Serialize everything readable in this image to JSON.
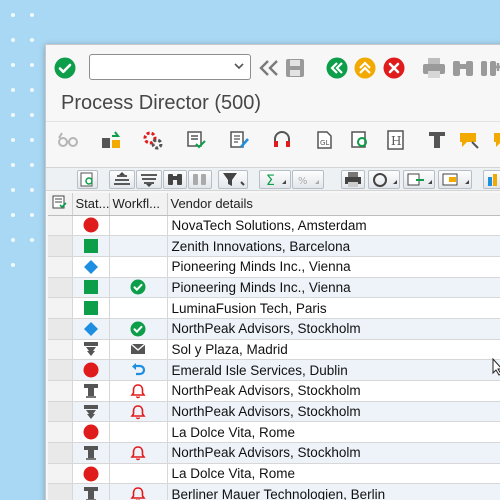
{
  "app": {
    "title": "Process Director (500)"
  },
  "toolbar": {
    "command_placeholder": ""
  },
  "table": {
    "headers": {
      "status": "Stat...",
      "workflow": "Workfl...",
      "vendor": "Vendor details"
    },
    "rows": [
      {
        "status": "red-circle-icon",
        "workflow": "",
        "vendor": "NovaTech Solutions, Amsterdam"
      },
      {
        "status": "green-square-icon",
        "workflow": "",
        "vendor": "Zenith Innovations, Barcelona"
      },
      {
        "status": "blue-diamond-icon",
        "workflow": "",
        "vendor": "Pioneering Minds Inc., Vienna"
      },
      {
        "status": "green-square-icon",
        "workflow": "check-icon",
        "vendor": "Pioneering Minds Inc., Vienna"
      },
      {
        "status": "green-square-icon",
        "workflow": "",
        "vendor": "LuminaFusion Tech, Paris"
      },
      {
        "status": "blue-diamond-icon",
        "workflow": "check-icon",
        "vendor": "NorthPeak Advisors, Stockholm"
      },
      {
        "status": "stamp-arrow-icon",
        "workflow": "envelope-icon",
        "vendor": "Sol y Plaza, Madrid"
      },
      {
        "status": "red-circle-icon",
        "workflow": "undo-arrow-icon",
        "vendor": "Emerald Isle Services, Dublin"
      },
      {
        "status": "stamp-icon",
        "workflow": "bell-icon",
        "vendor": "NorthPeak Advisors, Stockholm"
      },
      {
        "status": "stamp-arrow-icon",
        "workflow": "bell-icon",
        "vendor": "NorthPeak Advisors, Stockholm"
      },
      {
        "status": "red-circle-icon",
        "workflow": "",
        "vendor": "La Dolce Vita, Rome"
      },
      {
        "status": "stamp-icon",
        "workflow": "bell-icon",
        "vendor": "NorthPeak Advisors, Stockholm"
      },
      {
        "status": "red-circle-icon",
        "workflow": "",
        "vendor": "La Dolce Vita, Rome"
      },
      {
        "status": "stamp-icon",
        "workflow": "bell-icon",
        "vendor": "Berliner Mauer Technologien, Berlin"
      }
    ]
  },
  "colors": {
    "green": "#0d9e4a",
    "red": "#e01b1b",
    "blue": "#1e8fe0",
    "background": "#a9d8f4"
  }
}
